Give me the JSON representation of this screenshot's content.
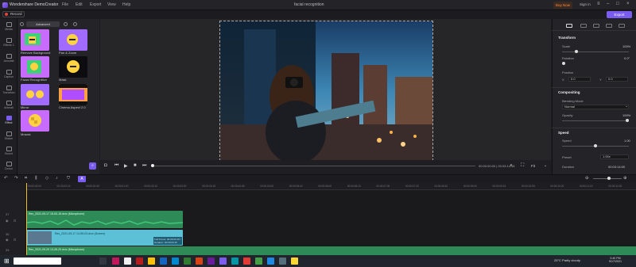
{
  "app": {
    "name": "Wondershare DemoCreator",
    "menu": [
      "File",
      "Edit",
      "Export",
      "View",
      "Help"
    ],
    "document_title": "facial recognition",
    "buy_now": "Buy Now",
    "sign_in": "Sign in",
    "record_label": "Record",
    "export_label": "Export",
    "accent": "#7b5cf0"
  },
  "rail": [
    {
      "label": "Media",
      "icon": "media-icon"
    },
    {
      "label": "Effects 1",
      "icon": "effects-icon"
    },
    {
      "label": "Annotati",
      "icon": "annotation-icon"
    },
    {
      "label": "Caption",
      "icon": "caption-icon"
    },
    {
      "label": "Transition",
      "icon": "transition-icon"
    },
    {
      "label": "Animati",
      "icon": "animation-icon"
    },
    {
      "label": "Effect",
      "icon": "effect-icon",
      "active": true
    },
    {
      "label": "Sticker",
      "icon": "sticker-icon"
    },
    {
      "label": "Sound",
      "icon": "sound-icon"
    },
    {
      "label": "Cursor",
      "icon": "cursor-icon"
    }
  ],
  "effects_panel": {
    "tab_label": "Advanced",
    "items": [
      {
        "label": "Remove Background"
      },
      {
        "label": "Pan & Zoom"
      },
      {
        "label": "Facial Recognition"
      },
      {
        "label": "Mask"
      },
      {
        "label": "Mirror"
      },
      {
        "label": "Cinema Aspect 2.0"
      },
      {
        "label": "Mosaic"
      }
    ]
  },
  "player": {
    "timecode": "00:00:00:00 | 00:03:14:15",
    "fit_label": "Fit"
  },
  "properties": {
    "transform": {
      "title": "Transform",
      "scale_label": "Scale",
      "scale_value": "100%",
      "scale_fraction": 0.2,
      "rotation_label": "Rotation",
      "rotation_value": "0.0°",
      "position_label": "Position",
      "x_label": "X",
      "x_value": "0.0",
      "y_label": "Y",
      "y_value": "0.0"
    },
    "compositing": {
      "title": "Compositing",
      "blending_label": "Blending Mode",
      "blending_value": "Normal",
      "opacity_label": "Opacity",
      "opacity_value": "100%",
      "opacity_fraction": 1.0
    },
    "speed": {
      "title": "Speed",
      "speed_label": "Speed",
      "speed_value": "1.00",
      "speed_fraction": 0.5,
      "preset_label": "Preset",
      "preset_value": "1.00x",
      "duration_label": "Duration",
      "duration_value": "00:03:14:00"
    }
  },
  "timeline": {
    "ruler": [
      "00:00:00:00",
      "00:00:00:15",
      "00:00:01:05",
      "00:00:01:20",
      "00:00:02:10",
      "00:00:03:00",
      "00:00:03:15",
      "00:00:04:05",
      "00:00:04:20",
      "00:00:05:10",
      "00:00:06:00",
      "00:00:06:15",
      "00:00:07:05",
      "00:00:07:20",
      "00:00:08:10",
      "00:00:09:00",
      "00:00:09:15",
      "00:00:10:05",
      "00:00:10:20",
      "00:00:11:10",
      "00:00:12:00"
    ],
    "tracks": [
      {
        "number": "37"
      },
      {
        "number": "36"
      },
      {
        "number": "35"
      }
    ],
    "clips": [
      {
        "label": "Rec_2021-09-17 15-00-15.dcrc (Microphone)",
        "color": "#2e8b57"
      },
      {
        "label": "Rec_2021-09-17 14-59-03.dcrc (Screen)",
        "color": "#5cc0d6",
        "footer": "Full Frame: 00:00:03:15 / Duration: 00:00:03:15"
      },
      {
        "label": "Rec_2021-09-20 13-26-20.dcrc (Microphone)",
        "color": "#2e8b57"
      }
    ]
  },
  "taskbar": {
    "weather": "25°C Partly cloudy",
    "time": "3:40 PM",
    "date": "9/17/2021"
  }
}
